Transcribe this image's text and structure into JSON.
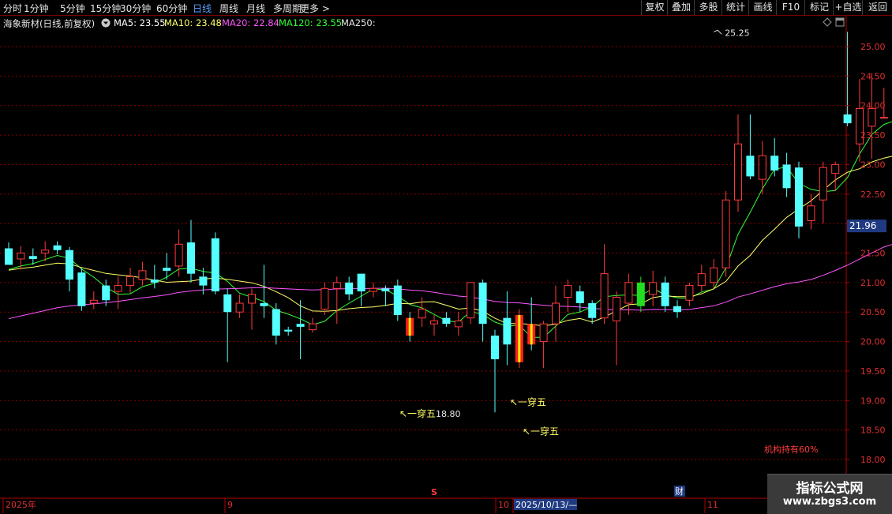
{
  "toolbar": {
    "periods": [
      "分时",
      "1分钟",
      "5分钟",
      "15分钟",
      "30分钟",
      "60分钟",
      "日线",
      "周线",
      "月线",
      "多周期",
      "更多 >"
    ],
    "active_period": "日线",
    "right_buttons": [
      "复权",
      "叠加",
      "多股",
      "统计",
      "画线",
      "F10",
      "标记",
      "+自选",
      "返回"
    ]
  },
  "info": {
    "stock_title": "海象新材(日线,前复权)",
    "ma5": "MA5: 23.55",
    "ma10": "MA10: 23.48",
    "ma20": "MA20: 22.84",
    "ma120": "MA120: 23.55",
    "ma250": "MA250:"
  },
  "colors": {
    "up": "#ff3b3b",
    "down": "#54ffff",
    "ma5": "#ffffff",
    "ma10": "#ffff66",
    "ma20": "#ff55ff",
    "ma120": "#33ff33",
    "grid": "#8a0000",
    "accent": "#5aa0ff"
  },
  "chart_data": {
    "type": "candlestick",
    "y_range": [
      17.8,
      25.4
    ],
    "y_ticks": [
      "25.00",
      "24.50",
      "24.00",
      "23.50",
      "23.00",
      "22.50",
      "22.00",
      "21.50",
      "21.00",
      "20.50",
      "20.00",
      "19.50",
      "19.00",
      "18.50",
      "18.00"
    ],
    "current_price_label": "21.96",
    "x_labels": [
      "2025年",
      "9",
      "10",
      "2025/10/13/—",
      "11"
    ],
    "high_label": "25.25",
    "low_label": "18.80",
    "signal_labels": [
      "一穿五",
      "一穿五",
      "一穿五"
    ],
    "institution_text": "机构持有60%",
    "marker_s": "S",
    "marker_cai": "财",
    "candles": [
      [
        21.58,
        21.3,
        21.68,
        21.3
      ],
      [
        21.4,
        21.5,
        21.62,
        21.22
      ],
      [
        21.45,
        21.4,
        21.58,
        21.3
      ],
      [
        21.5,
        21.55,
        21.7,
        21.36
      ],
      [
        21.63,
        21.55,
        21.7,
        21.48
      ],
      [
        21.55,
        21.05,
        21.6,
        20.85
      ],
      [
        21.17,
        20.6,
        21.25,
        20.52
      ],
      [
        20.65,
        20.7,
        20.85,
        20.55
      ],
      [
        20.95,
        20.7,
        21.05,
        20.6
      ],
      [
        20.85,
        20.95,
        21.1,
        20.55
      ],
      [
        20.95,
        21.1,
        21.25,
        20.82
      ],
      [
        21.05,
        21.2,
        21.35,
        20.95
      ],
      [
        21.05,
        21.0,
        21.3,
        20.9
      ],
      [
        21.25,
        21.2,
        21.5,
        21.05
      ],
      [
        21.28,
        21.65,
        21.9,
        21.1
      ],
      [
        21.68,
        21.15,
        22.06,
        21.0
      ],
      [
        21.1,
        20.95,
        21.25,
        20.8
      ],
      [
        21.75,
        20.85,
        21.85,
        20.8
      ],
      [
        20.8,
        20.5,
        20.9,
        19.65
      ],
      [
        20.5,
        20.65,
        20.8,
        20.4
      ],
      [
        20.65,
        20.8,
        20.9,
        20.2
      ],
      [
        20.65,
        20.6,
        21.3,
        20.4
      ],
      [
        20.55,
        20.1,
        20.65,
        19.95
      ],
      [
        20.2,
        20.17,
        20.25,
        20.1
      ],
      [
        20.3,
        20.25,
        20.7,
        19.7
      ],
      [
        20.2,
        20.3,
        20.4,
        20.15
      ],
      [
        20.55,
        20.9,
        21.0,
        20.45
      ],
      [
        20.9,
        21.0,
        21.1,
        20.3
      ],
      [
        21.0,
        20.8,
        21.1,
        20.7
      ],
      [
        21.15,
        20.85,
        21.15,
        20.6
      ],
      [
        20.85,
        20.9,
        21.0,
        20.75
      ],
      [
        20.9,
        20.85,
        20.95,
        20.6
      ],
      [
        20.95,
        20.45,
        21.05,
        20.35
      ],
      [
        20.4,
        20.1,
        20.5,
        20.0
      ],
      [
        20.4,
        20.55,
        20.75,
        20.25
      ],
      [
        20.3,
        20.35,
        20.45,
        20.1
      ],
      [
        20.4,
        20.3,
        20.5,
        20.25
      ],
      [
        20.25,
        20.35,
        20.5,
        20.1
      ],
      [
        20.4,
        21.0,
        21.0,
        20.3
      ],
      [
        21.0,
        20.3,
        21.05,
        20.0
      ],
      [
        20.1,
        19.7,
        20.2,
        18.8
      ],
      [
        20.4,
        19.95,
        20.85,
        19.6
      ],
      [
        19.65,
        20.45,
        20.55,
        19.55
      ],
      [
        20.3,
        19.95,
        20.75,
        19.85
      ],
      [
        20.0,
        20.3,
        20.35,
        19.55
      ],
      [
        20.3,
        20.65,
        20.95,
        20.0
      ],
      [
        20.75,
        20.95,
        21.05,
        20.5
      ],
      [
        20.85,
        20.65,
        20.95,
        20.5
      ],
      [
        20.65,
        20.4,
        20.7,
        20.3
      ],
      [
        20.4,
        21.15,
        21.65,
        20.3
      ],
      [
        20.35,
        20.75,
        20.85,
        19.6
      ],
      [
        20.65,
        21.0,
        21.15,
        20.45
      ],
      [
        21.0,
        20.6,
        21.1,
        20.5
      ],
      [
        20.8,
        21.0,
        21.2,
        20.6
      ],
      [
        21.0,
        20.6,
        21.1,
        20.5
      ],
      [
        20.6,
        20.5,
        20.7,
        20.4
      ],
      [
        20.7,
        20.95,
        21.0,
        20.6
      ],
      [
        20.95,
        21.15,
        21.3,
        20.85
      ],
      [
        21.0,
        21.25,
        21.4,
        20.9
      ],
      [
        21.25,
        22.4,
        22.55,
        21.1
      ],
      [
        22.4,
        23.35,
        23.85,
        22.2
      ],
      [
        23.15,
        22.8,
        23.85,
        22.75
      ],
      [
        22.75,
        23.15,
        23.4,
        22.5
      ],
      [
        23.15,
        22.9,
        23.45,
        22.8
      ],
      [
        23.0,
        22.6,
        23.2,
        22.45
      ],
      [
        22.95,
        21.95,
        23.05,
        21.75
      ],
      [
        22.05,
        22.3,
        22.5,
        21.9
      ],
      [
        22.4,
        22.95,
        23.05,
        22.0
      ],
      [
        22.85,
        23.0,
        23.05,
        22.55
      ],
      [
        23.85,
        23.7,
        25.25,
        23.65
      ],
      [
        23.35,
        23.95,
        24.45,
        23.05
      ],
      [
        23.65,
        23.95,
        24.55,
        23.1
      ],
      [
        23.8,
        23.8,
        24.3,
        23.8
      ],
      [
        23.65,
        23.35,
        23.75,
        23.1
      ],
      [
        23.35,
        23.35,
        23.45,
        23.25
      ],
      [
        23.4,
        23.0,
        23.45,
        22.95
      ],
      [
        23.0,
        24.32,
        24.6,
        23.0
      ]
    ]
  }
}
